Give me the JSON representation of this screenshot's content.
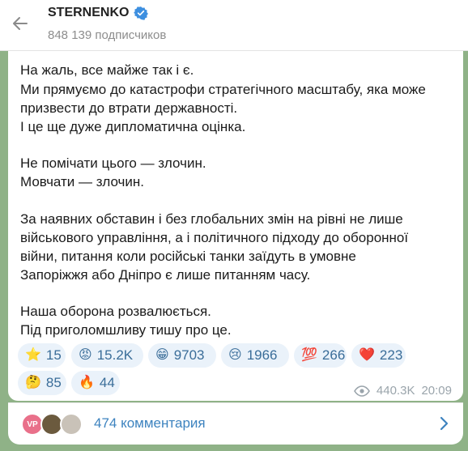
{
  "header": {
    "title": "STERNENKO",
    "subscribers": "848 139 подписчиков"
  },
  "message": {
    "lines": [
      "На жаль, все майже так і є.",
      "Ми прямуємо до катастрофи стратегічного масштабу, яка може",
      "призвести до втрати державності.",
      "І це ще дуже дипломатична оцінка.",
      "Не помічати цього — злочин.",
      "Мовчати — злочин.",
      "За наявних обставин і без глобальних змін на рівні не лише",
      "військового управління, а і політичного підходу до оборонної",
      "війни, питання коли російські танки заїдуть в умовне",
      "Запоріжжя або Дніпро є лише питанням часу.",
      "Наша оборона розвалюється.",
      "Під приголомшливу тишу про це."
    ],
    "reactions": [
      {
        "emoji": "⭐",
        "count": "15"
      },
      {
        "emoji": "😡",
        "count": "15.2K"
      },
      {
        "emoji": "😁",
        "count": "9703"
      },
      {
        "emoji": "😢",
        "count": "1966"
      },
      {
        "emoji": "💯",
        "count": "266"
      },
      {
        "emoji": "❤️",
        "count": "223"
      },
      {
        "emoji": "🤔",
        "count": "85"
      },
      {
        "emoji": "🔥",
        "count": "44"
      }
    ],
    "views": "440.3K",
    "time": "20:09"
  },
  "comments": {
    "avatar_initials": "VP",
    "label": "474 комментария"
  },
  "colors": {
    "accent": "#3d83bf",
    "verified": "#3d8fe0",
    "reaction_bg": "#eaf2fa",
    "chat_bg": "#8fb287"
  }
}
